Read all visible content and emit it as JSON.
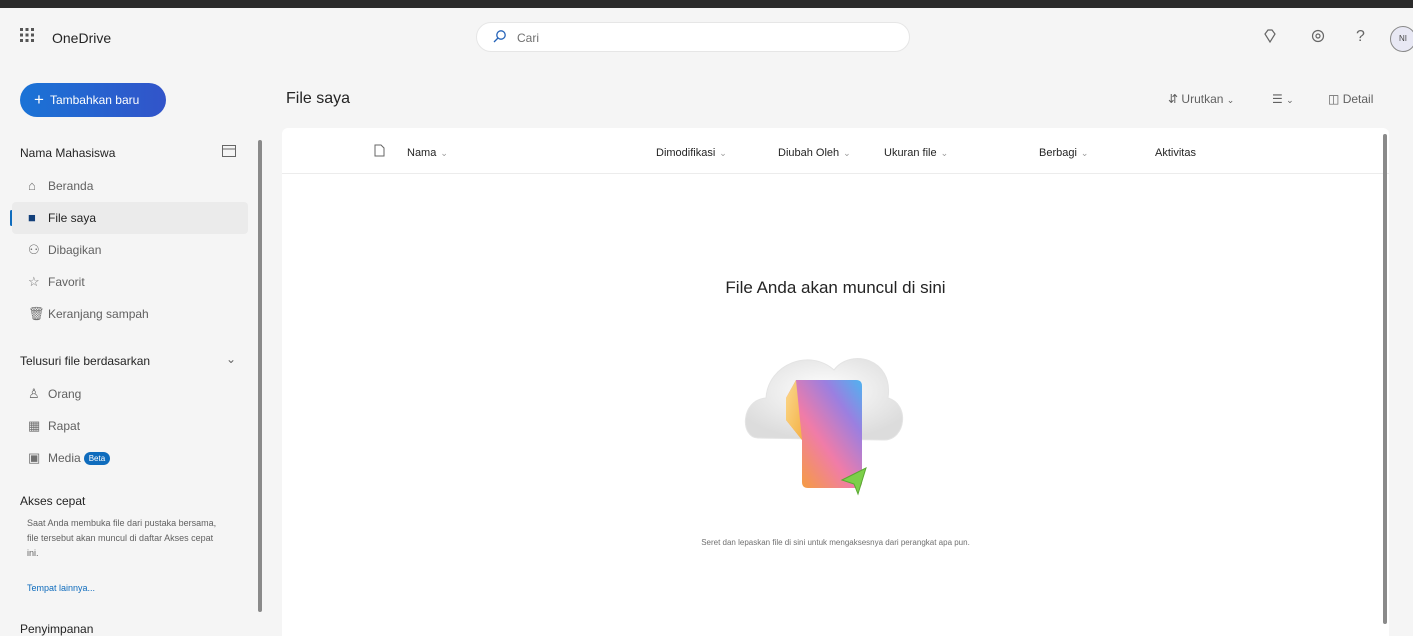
{
  "header": {
    "app_name": "OneDrive",
    "search_placeholder": "Cari",
    "avatar_initials": "NI"
  },
  "sidebar": {
    "add_button": "Tambahkan baru",
    "user_section": "Nama Mahasiswa",
    "nav_items": [
      {
        "label": "Beranda",
        "icon": "home-icon"
      },
      {
        "label": "File saya",
        "icon": "folder-icon",
        "active": true
      },
      {
        "label": "Dibagikan",
        "icon": "people-icon"
      },
      {
        "label": "Favorit",
        "icon": "star-icon"
      },
      {
        "label": "Keranjang sampah",
        "icon": "trash-icon"
      }
    ],
    "browse_section": "Telusuri file berdasarkan",
    "browse_items": [
      {
        "label": "Orang",
        "icon": "person-icon"
      },
      {
        "label": "Rapat",
        "icon": "calendar-icon"
      },
      {
        "label": "Media",
        "icon": "image-icon",
        "badge": "Beta"
      }
    ],
    "quick_access_title": "Akses cepat",
    "quick_access_desc": "Saat Anda membuka file dari pustaka bersama, file tersebut akan muncul di daftar Akses cepat ini.",
    "quick_access_link": "Tempat lainnya...",
    "storage_title": "Penyimpanan"
  },
  "main": {
    "title": "File saya",
    "toolbar": {
      "sort": "Urutkan",
      "view": "",
      "details": "Detail"
    },
    "columns": [
      "Nama",
      "Dimodifikasi",
      "Diubah Oleh",
      "Ukuran file",
      "Berbagi",
      "Aktivitas"
    ],
    "empty_title": "File Anda akan muncul di sini",
    "empty_sub": "Seret dan lepaskan file di sini untuk mengaksesnya dari perangkat apa pun."
  },
  "colors": {
    "accent": "#0f6cbd",
    "add_button_start": "#1a73d6",
    "add_button_end": "#3254c9"
  }
}
